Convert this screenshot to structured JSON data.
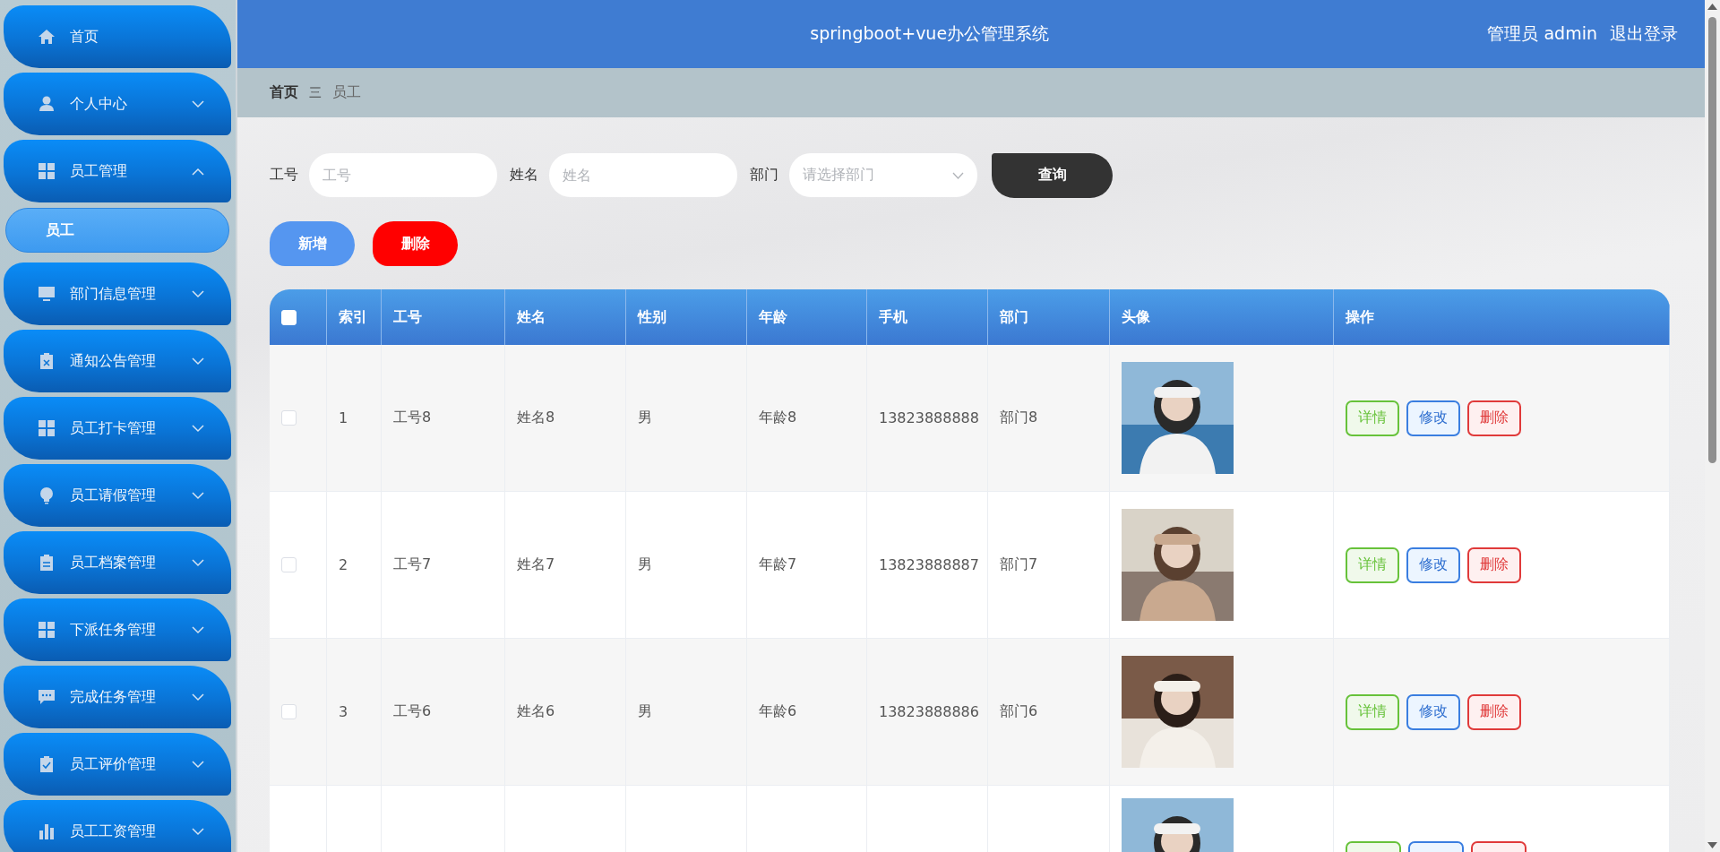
{
  "sidebar": {
    "items": [
      {
        "kind": "link",
        "label": "首页"
      },
      {
        "kind": "menu",
        "label": "个人中心",
        "expanded": false
      },
      {
        "kind": "menu",
        "label": "员工管理",
        "expanded": true,
        "children": [
          {
            "label": "员工",
            "selected": true
          }
        ]
      },
      {
        "kind": "menu",
        "label": "部门信息管理",
        "expanded": false
      },
      {
        "kind": "menu",
        "label": "通知公告管理",
        "expanded": false
      },
      {
        "kind": "menu",
        "label": "员工打卡管理",
        "expanded": false
      },
      {
        "kind": "menu",
        "label": "员工请假管理",
        "expanded": false
      },
      {
        "kind": "menu",
        "label": "员工档案管理",
        "expanded": false
      },
      {
        "kind": "menu",
        "label": "下派任务管理",
        "expanded": false
      },
      {
        "kind": "menu",
        "label": "完成任务管理",
        "expanded": false
      },
      {
        "kind": "menu",
        "label": "员工评价管理",
        "expanded": false
      },
      {
        "kind": "menu",
        "label": "员工工资管理",
        "expanded": false
      }
    ]
  },
  "header": {
    "title": "springboot+vue办公管理系统",
    "user": "管理员 admin",
    "logout": "退出登录"
  },
  "breadcrumb": {
    "items": [
      "首页",
      "员工"
    ],
    "separator": "三"
  },
  "search": {
    "fields": [
      {
        "kind": "input",
        "label": "工号",
        "placeholder": "工号"
      },
      {
        "kind": "input",
        "label": "姓名",
        "placeholder": "姓名"
      },
      {
        "kind": "select",
        "label": "部门",
        "placeholder": "请选择部门"
      }
    ],
    "button": "查询"
  },
  "actions": [
    {
      "kind": "add",
      "label": "新增"
    },
    {
      "kind": "delete",
      "label": "删除"
    }
  ],
  "table": {
    "select_all": false,
    "columns": [
      "索引",
      "工号",
      "姓名",
      "性别",
      "年龄",
      "手机",
      "部门",
      "头像",
      "操作"
    ],
    "rows": [
      {
        "checked": false,
        "cells": [
          "1",
          "工号8",
          "姓名8",
          "男",
          "年龄8",
          "13823888888",
          "部门8"
        ],
        "photo": {
          "kind": "picture"
        },
        "buttons": [
          "详情",
          "修改",
          "删除"
        ]
      },
      {
        "checked": false,
        "cells": [
          "2",
          "工号7",
          "姓名7",
          "男",
          "年龄7",
          "13823888887",
          "部门7"
        ],
        "photo": {
          "kind": "picture"
        },
        "buttons": [
          "详情",
          "修改",
          "删除"
        ]
      },
      {
        "checked": false,
        "cells": [
          "3",
          "工号6",
          "姓名6",
          "男",
          "年龄6",
          "13823888886",
          "部门6"
        ],
        "photo": {
          "kind": "picture"
        },
        "buttons": [
          "详情",
          "修改",
          "删除"
        ]
      },
      {
        "partial": true,
        "photo": {
          "kind": "picture"
        }
      }
    ]
  }
}
